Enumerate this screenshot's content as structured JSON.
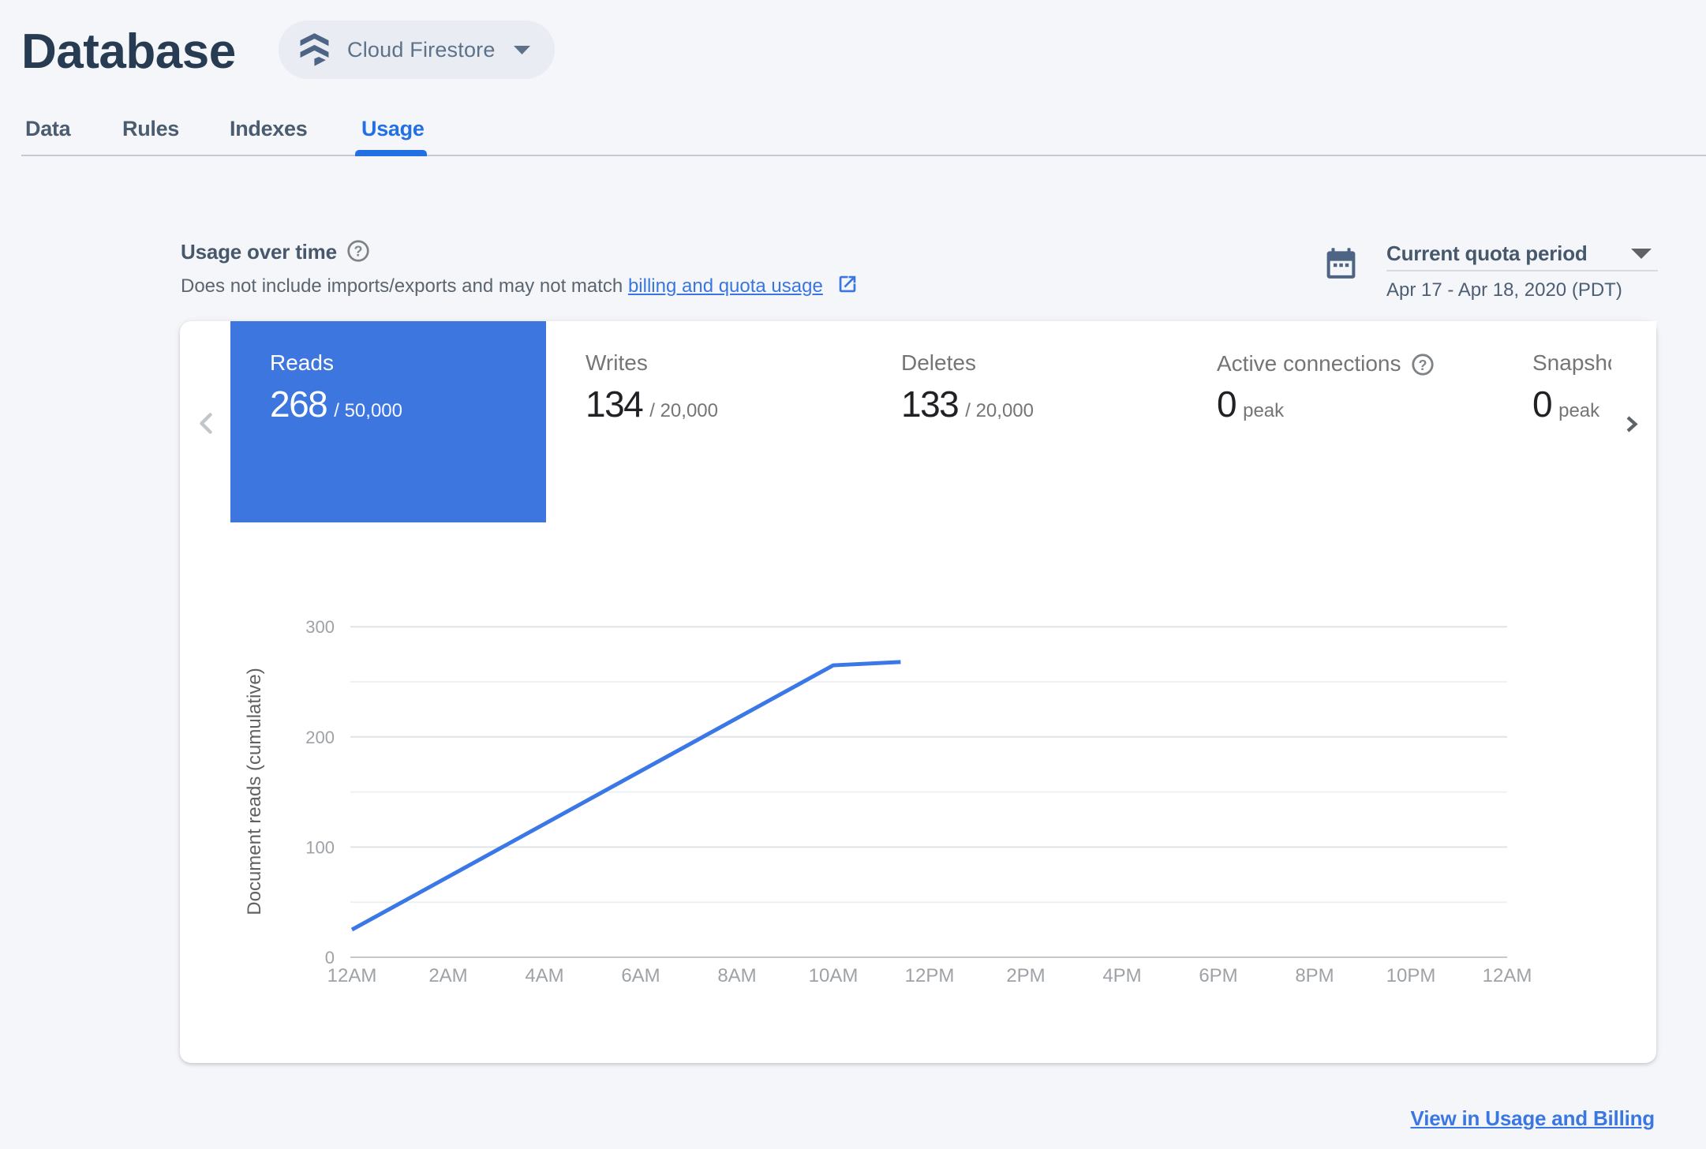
{
  "page": {
    "title": "Database"
  },
  "product_selector": {
    "label": "Cloud Firestore"
  },
  "tabs": [
    {
      "label": "Data"
    },
    {
      "label": "Rules"
    },
    {
      "label": "Indexes"
    },
    {
      "label": "Usage"
    }
  ],
  "section": {
    "title": "Usage over time",
    "subtitle_prefix": "Does not include imports/exports and may not match ",
    "subtitle_link": "billing and quota usage",
    "period_label": "Current quota period",
    "period_range": "Apr 17 - Apr 18, 2020 (PDT)"
  },
  "metrics": [
    {
      "label": "Reads",
      "value": "268",
      "suffix": "/ 50,000",
      "selected": true
    },
    {
      "label": "Writes",
      "value": "134",
      "suffix": "/ 20,000"
    },
    {
      "label": "Deletes",
      "value": "133",
      "suffix": "/ 20,000"
    },
    {
      "label": "Active connections",
      "value": "0",
      "suffix": "peak"
    },
    {
      "label": "Snapshot listeners",
      "value": "0",
      "suffix": "peak"
    }
  ],
  "footer": {
    "link_label": "View in Usage and Billing"
  },
  "chart_data": {
    "type": "line",
    "ylabel": "Document reads (cumulative)",
    "xlabel": "",
    "x_tick_labels": [
      "12AM",
      "2AM",
      "4AM",
      "6AM",
      "8AM",
      "10AM",
      "12PM",
      "2PM",
      "4PM",
      "6PM",
      "8PM",
      "10PM",
      "12AM"
    ],
    "x_tick_hours": [
      0,
      2,
      4,
      6,
      8,
      10,
      12,
      14,
      16,
      18,
      20,
      22,
      24
    ],
    "y_major_ticks": [
      0,
      100,
      200,
      300
    ],
    "y_minor_ticks": [
      50,
      150,
      250
    ],
    "ylim": [
      0,
      300
    ],
    "xlim_hours": [
      0,
      24
    ],
    "grid": "horizontal",
    "legend": "none",
    "series": [
      {
        "name": "Document reads (cumulative)",
        "x_hours": [
          0,
          10,
          11.4
        ],
        "values": [
          25,
          265,
          268
        ]
      }
    ],
    "line_color": "#3b78e7"
  },
  "colors": {
    "accent_blue": "#2270e3",
    "selected_tab_blue": "#3d76de",
    "link_blue": "#3a76e0",
    "slate_icon": "#4d6484",
    "page_bg": "#f5f6f9"
  }
}
